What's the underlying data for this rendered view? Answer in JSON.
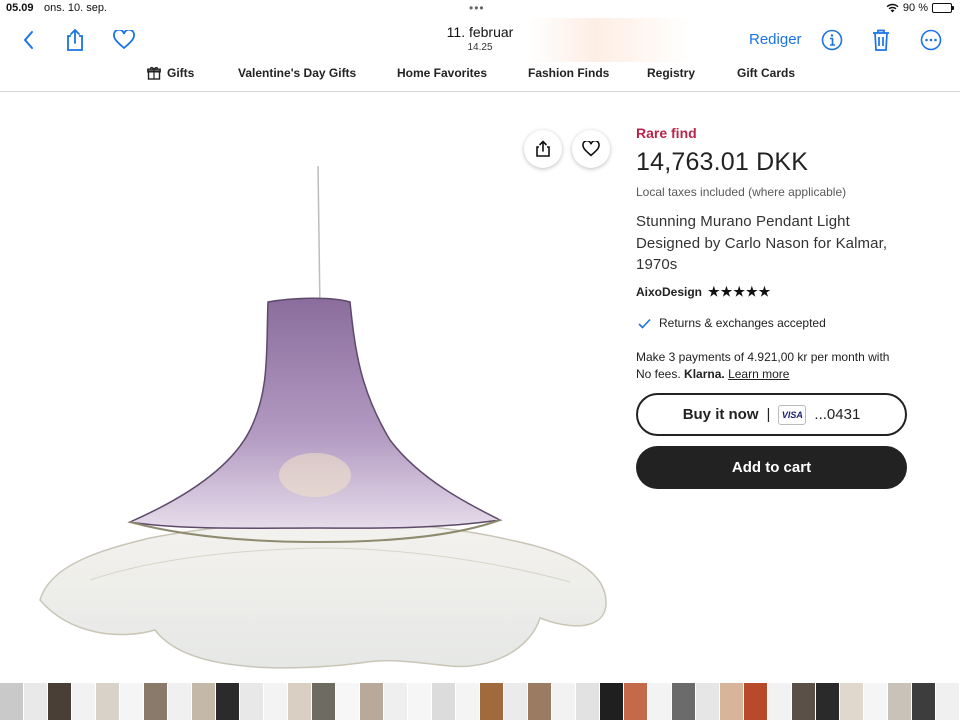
{
  "status_bar": {
    "time": "05.09",
    "date": "ons. 10. sep.",
    "battery": "90 %"
  },
  "photo_toolbar": {
    "title": "11. februar",
    "subtitle": "14.25",
    "edit_label": "Rediger"
  },
  "nav": {
    "gifts": "Gifts",
    "valentines": "Valentine's Day Gifts",
    "home": "Home Favorites",
    "fashion": "Fashion Finds",
    "registry": "Registry",
    "gift_cards": "Gift Cards"
  },
  "product": {
    "badge": "Rare find",
    "price": "14,763.01 DKK",
    "tax_note": "Local taxes included (where applicable)",
    "title": "Stunning Murano Pendant Light Designed by Carlo Nason for Kalmar, 1970s",
    "shop": "AixoDesign",
    "stars": "★★★★★",
    "returns": "Returns & exchanges accepted",
    "klarna_text": "Make 3 payments of 4.921,00 kr per month with No fees.",
    "klarna_brand": "Klarna.",
    "klarna_link": "Learn more",
    "buy_now": "Buy it now",
    "buy_sep": "|",
    "card_brand": "VISA",
    "card_number": "...0431",
    "add_to_cart": "Add to cart"
  },
  "colors": {
    "accent": "#1a73e8",
    "rare": "#b5264b",
    "button_dark": "#222222"
  },
  "filmstrip": [
    "#c9c9c9",
    "#e9e9e9",
    "#4a3f36",
    "#f2f2f2",
    "#d8d2c8",
    "#f5f5f5",
    "#8a7a6a",
    "#f0f0f0",
    "#c4b8a8",
    "#2b2b2b",
    "#e8e8e8",
    "#f3f3f3",
    "#d9cfc3",
    "#6e6b62",
    "#f7f7f7",
    "#b8a99a",
    "#efefef",
    "#f6f6f6",
    "#dcdcdc",
    "#f4f4f4",
    "#a06a3c",
    "#ebebeb",
    "#9b7b62",
    "#f2f2f2",
    "#e2e2e2",
    "#1f1f1f",
    "#c46a4a",
    "#f3f3f3",
    "#6b6b6b",
    "#e6e6e6",
    "#d8b59a",
    "#b84a2b",
    "#f2f2f2",
    "#5a5048",
    "#2a2a2a",
    "#e0d8cc",
    "#f5f5f5",
    "#c9c2b8",
    "#3d3d3d",
    "#f0f0f0"
  ]
}
